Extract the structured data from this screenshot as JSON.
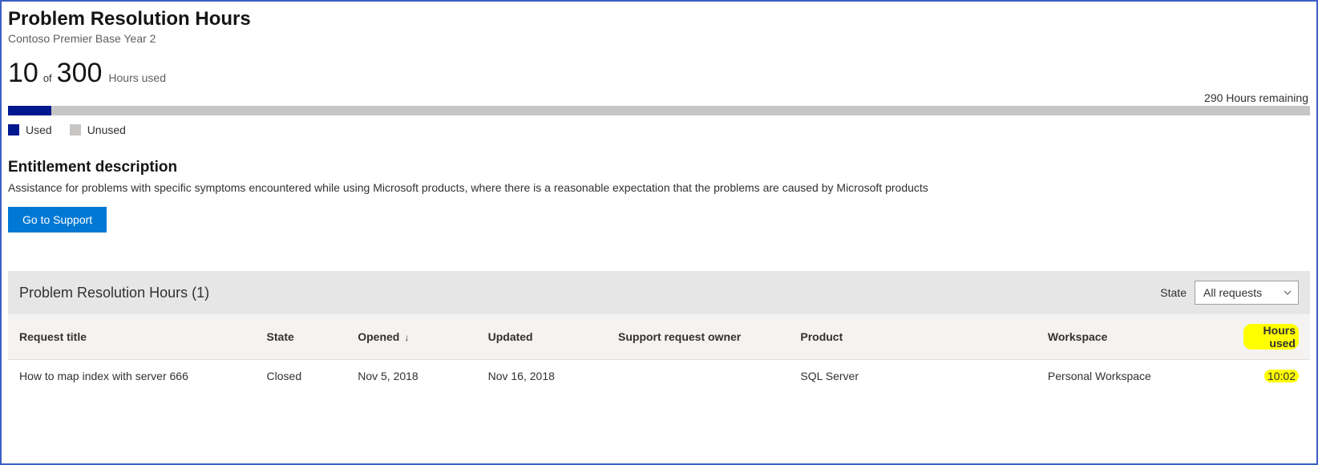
{
  "header": {
    "title": "Problem Resolution Hours",
    "subtitle": "Contoso Premier Base Year 2"
  },
  "usage": {
    "used": "10",
    "of_label": "of",
    "total": "300",
    "hours_used_label": "Hours used",
    "remaining_text": "290 Hours remaining",
    "progress_percent": 3.33,
    "legend_used": "Used",
    "legend_unused": "Unused"
  },
  "entitlement": {
    "title": "Entitlement description",
    "description": "Assistance for problems with specific symptoms encountered while using Microsoft products, where there is a reasonable expectation that the problems are caused by Microsoft products",
    "support_button": "Go to Support"
  },
  "table": {
    "title": "Problem Resolution Hours (1)",
    "state_label": "State",
    "state_selected": "All requests",
    "columns": {
      "request_title": "Request title",
      "state": "State",
      "opened": "Opened",
      "updated": "Updated",
      "owner": "Support request owner",
      "product": "Product",
      "workspace": "Workspace",
      "hours_used": "Hours used"
    },
    "sort_indicator": "↓",
    "rows": [
      {
        "request_title": "How to map index with server 666",
        "state": "Closed",
        "opened": "Nov 5, 2018",
        "updated": "Nov 16, 2018",
        "owner": "",
        "product": "SQL Server",
        "workspace": "Personal Workspace",
        "hours_used": "10:02"
      }
    ]
  },
  "chart_data": {
    "type": "bar",
    "title": "Problem Resolution Hours",
    "categories": [
      "Used",
      "Unused"
    ],
    "values": [
      10,
      290
    ],
    "total": 300,
    "xlabel": "",
    "ylabel": "Hours",
    "ylim": [
      0,
      300
    ]
  }
}
